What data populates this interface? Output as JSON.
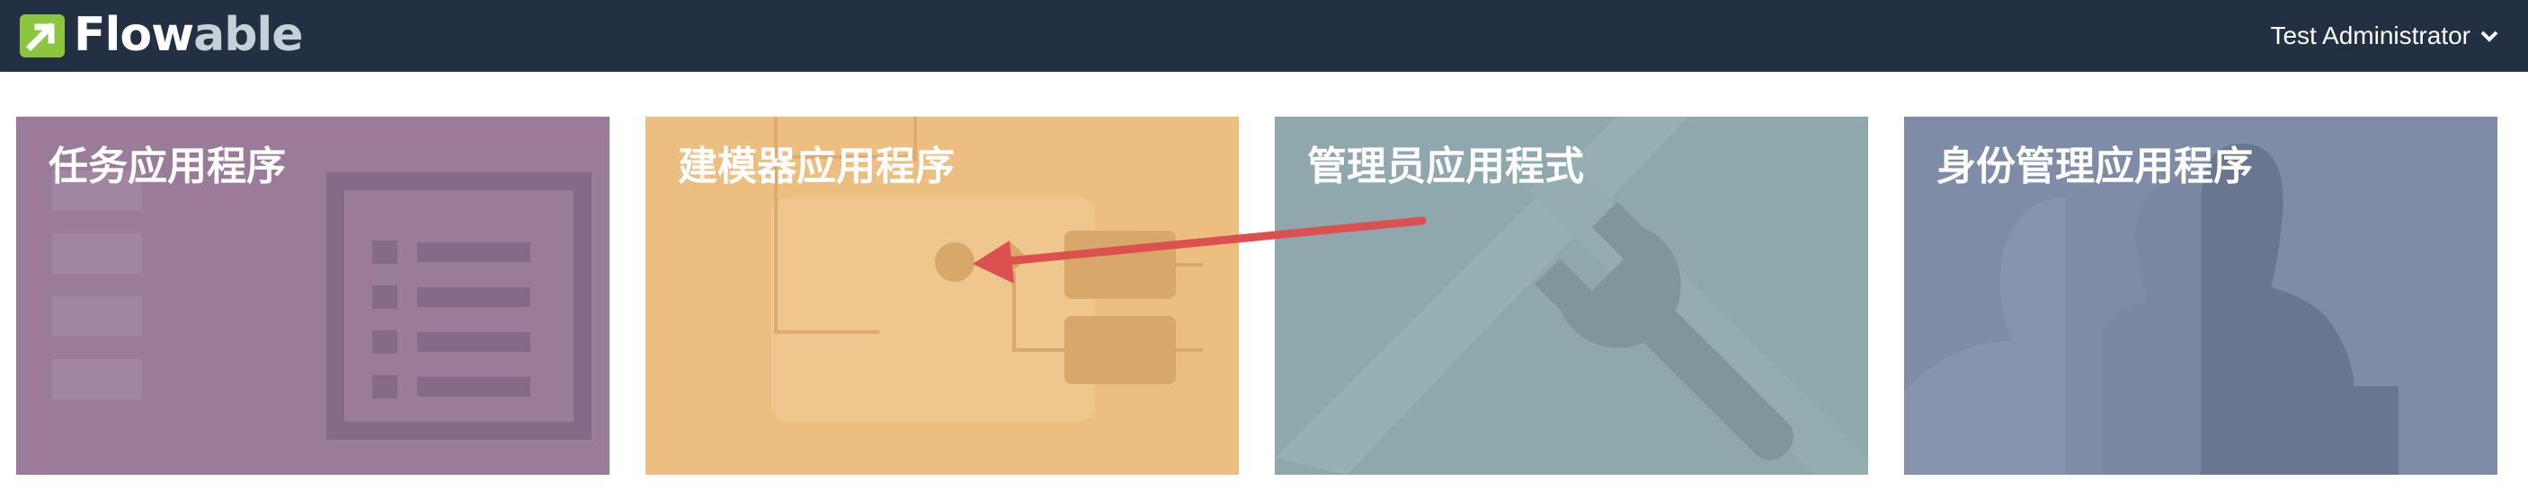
{
  "header": {
    "brand_part1": "Flow",
    "brand_part2": "able",
    "user_name": "Test Administrator",
    "navbar_color": "#232f43"
  },
  "tiles": [
    {
      "title": "任务应用程序",
      "icon": "task-list-icon",
      "color": "#9a7b9a"
    },
    {
      "title": "建模器应用程序",
      "icon": "process-diagram-icon",
      "color": "#ecbf81"
    },
    {
      "title": "管理员应用程式",
      "icon": "wrench-icon",
      "color": "#8fa8ad"
    },
    {
      "title": "身份管理应用程序",
      "icon": "user-silhouette-icon",
      "color": "#7f8ca7"
    }
  ],
  "annotation": {
    "icon": "red-arrow-annotation",
    "color": "#dd5050"
  }
}
